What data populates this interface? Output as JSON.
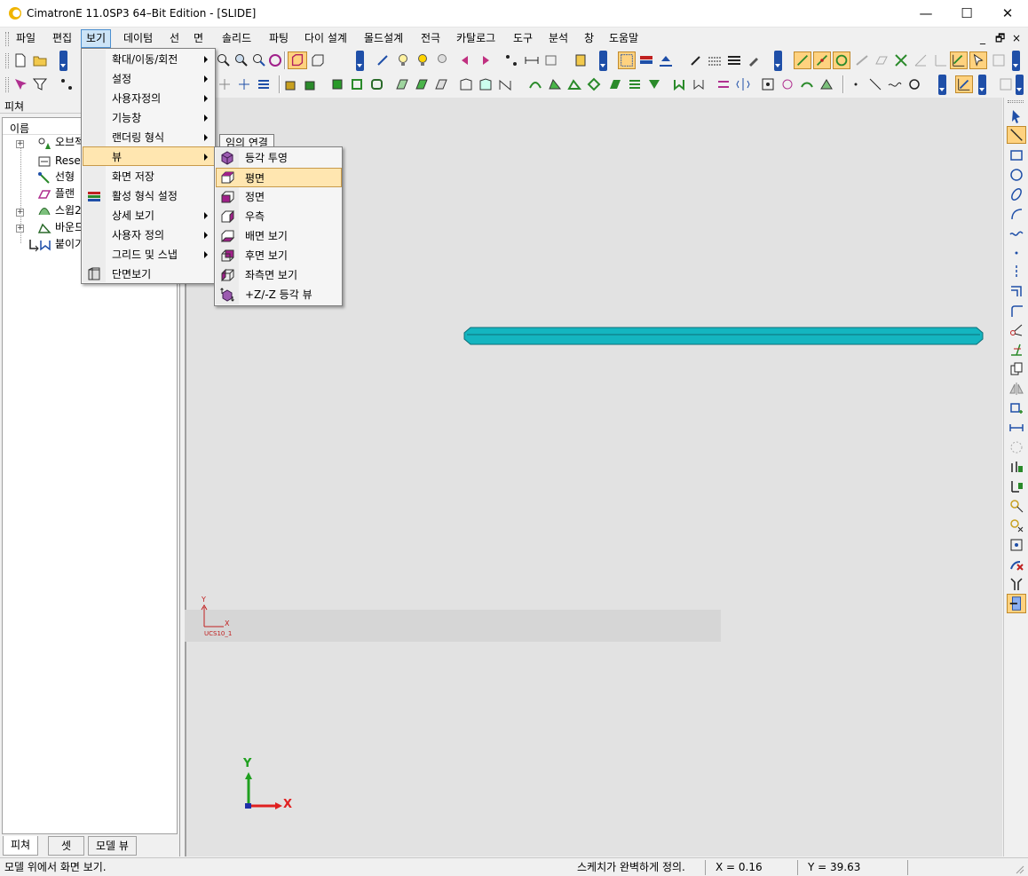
{
  "window": {
    "title": "CimatronE 11.0SP3 64–Bit Edition - [SLIDE]",
    "minimize": "—",
    "maximize": "☐",
    "close": "✕"
  },
  "menubar": {
    "items": [
      "파일",
      "편집",
      "보기",
      "데이텀",
      "선",
      "면",
      "솔리드",
      "파팅",
      "다이 설계",
      "몰드설계",
      "전극",
      "카탈로그",
      "도구",
      "분석",
      "창",
      "도움말"
    ],
    "active": "보기",
    "mdi_controls": [
      "_",
      "🗗",
      "×"
    ]
  },
  "view_menu": {
    "items": [
      {
        "label": "확대/이동/회전",
        "submenu": true
      },
      {
        "label": "설정",
        "submenu": true
      },
      {
        "label": "사용자정의",
        "submenu": true
      },
      {
        "label": "기능창",
        "submenu": true
      },
      {
        "label": "랜더링 형식",
        "submenu": true
      },
      {
        "label": "뷰",
        "submenu": true
      },
      {
        "label": "화면 저장",
        "submenu": false
      },
      {
        "label": "활성 형식 설정",
        "submenu": false
      },
      {
        "label": "상세 보기",
        "submenu": true
      },
      {
        "label": "사용자 정의",
        "submenu": true
      },
      {
        "label": "그리드 및 스냅",
        "submenu": true
      },
      {
        "label": "단면보기",
        "submenu": false
      }
    ],
    "highlighted": "뷰"
  },
  "view_submenu": {
    "items": [
      "등각 투영",
      "평면",
      "정면",
      "우측",
      "배면 보기",
      "후면 보기",
      "좌측면 보기",
      "+Z/-Z 등각 뷰"
    ],
    "highlighted": "평면"
  },
  "feature_panel": {
    "header": "피쳐",
    "column": "이름",
    "tree": [
      "오브젝",
      "Reset",
      "선형",
      "플랜",
      "스윕2",
      "바운드",
      "붙이기"
    ],
    "tabs": [
      "피쳐",
      "셋",
      "모델 뷰"
    ]
  },
  "viewport": {
    "temp_link_label": "임의 연결",
    "ucs_label": "UCS10_1",
    "ucs_axis_y": "Y",
    "ucs_axis_x": "X",
    "triad_y": "Y",
    "triad_x": "X",
    "slide_color": "#14b5c0"
  },
  "status": {
    "message": "모델 위에서 화면 보기.",
    "sketch_state": "스케치가 완벽하게 정의.",
    "x_readout": "X = 0.16",
    "y_readout": "Y = 39.63"
  },
  "colors": {
    "accent_blue": "#1f4fa8",
    "menu_highlight": "#ffe6b0",
    "triad_x": "#e02020",
    "triad_y": "#20a020"
  }
}
